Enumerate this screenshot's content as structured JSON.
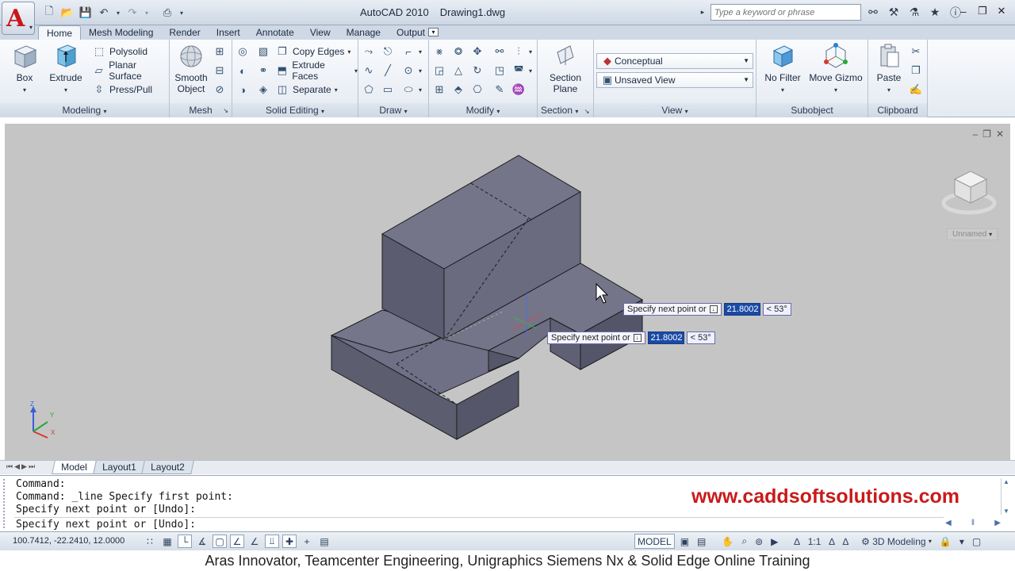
{
  "title_bar": {
    "app_name": "AutoCAD 2010",
    "document": "Drawing1.dwg",
    "search_placeholder": "Type a keyword or phrase"
  },
  "ribbon_tabs": [
    "Home",
    "Mesh Modeling",
    "Render",
    "Insert",
    "Annotate",
    "View",
    "Manage",
    "Output"
  ],
  "active_tab": "Home",
  "ribbon": {
    "modeling": {
      "title": "Modeling",
      "box": "Box",
      "extrude": "Extrude",
      "polysolid": "Polysolid",
      "planar_surface": "Planar Surface",
      "press_pull": "Press/Pull"
    },
    "mesh": {
      "title": "Mesh",
      "smooth_object_line1": "Smooth",
      "smooth_object_line2": "Object"
    },
    "solid_editing": {
      "title": "Solid Editing",
      "copy_edges": "Copy Edges",
      "extrude_faces": "Extrude Faces",
      "separate": "Separate"
    },
    "draw": {
      "title": "Draw"
    },
    "modify": {
      "title": "Modify"
    },
    "section": {
      "title": "Section",
      "section_plane_line1": "Section",
      "section_plane_line2": "Plane"
    },
    "view": {
      "title": "View",
      "visual_style": "Conceptual",
      "named_view": "Unsaved View"
    },
    "subobject": {
      "title": "Subobject",
      "no_filter": "No Filter",
      "move_gizmo": "Move Gizmo"
    },
    "clipboard": {
      "title": "Clipboard",
      "paste": "Paste"
    }
  },
  "viewport": {
    "ucs_name": "Unnamed",
    "dynamic_input": [
      {
        "prompt": "Specify next point or",
        "value": "21.8002",
        "angle": "< 53°"
      },
      {
        "prompt": "Specify next point or",
        "value": "21.8002",
        "angle": "< 53°"
      }
    ],
    "axis_labels": {
      "x": "X",
      "y": "Y",
      "z": "Z"
    }
  },
  "layout_tabs": [
    "Model",
    "Layout1",
    "Layout2"
  ],
  "active_layout": "Model",
  "command_line": {
    "history": [
      "Command:",
      "Command: _line Specify first point:",
      "Specify next point or [Undo]:"
    ],
    "current": "Specify next point or [Undo]:",
    "watermark": "www.caddsoftsolutions.com"
  },
  "status_bar": {
    "coordinates": "100.7412, -22.2410, 12.0000",
    "model_label": "MODEL",
    "annotation_scale": "1:1",
    "workspace": "3D Modeling"
  },
  "caption": "Aras Innovator, Teamcenter Engineering, Unigraphics Siemens Nx & Solid Edge Online Training",
  "colors": {
    "accent_red": "#c81b1b",
    "viewport_bg": "#c5c5c5",
    "solid_face": "#6a6a80",
    "dyn_input_highlight": "#1a4aa6"
  }
}
